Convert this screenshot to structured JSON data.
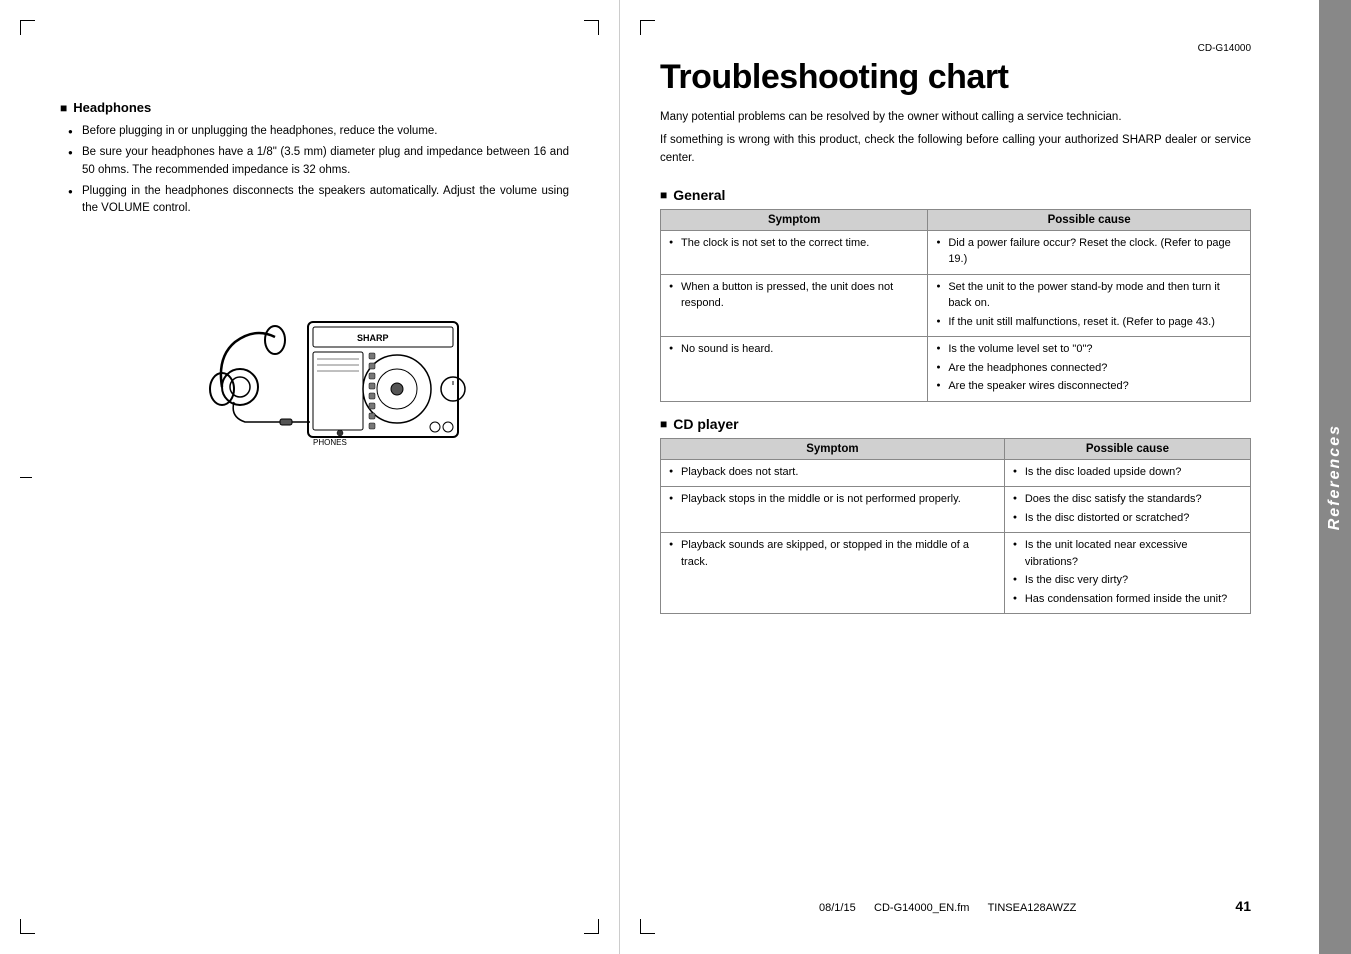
{
  "left": {
    "section_title": "Headphones",
    "bullets": [
      "Before plugging in or unplugging the headphones, reduce the volume.",
      "Be sure your headphones have a 1/8\" (3.5 mm) diameter plug and impedance between 16 and 50 ohms. The recommended impedance is 32 ohms.",
      "Plugging in the headphones disconnects the speakers automatically. Adjust the volume using the VOLUME control."
    ],
    "phones_label": "PHONES"
  },
  "right": {
    "model": "CD-G14000",
    "title": "Troubleshooting chart",
    "intro1": "Many potential problems can be resolved by the owner without calling a service technician.",
    "intro2": "If something is wrong with this product, check the following before calling your authorized SHARP dealer or service center.",
    "general": {
      "heading": "General",
      "col1": "Symptom",
      "col2": "Possible cause",
      "rows": [
        {
          "symptom": [
            "The clock is not set to the correct time."
          ],
          "cause": [
            "Did a power failure occur? Reset the clock. (Refer to page 19.)"
          ]
        },
        {
          "symptom": [
            "When a button is pressed, the unit does not respond."
          ],
          "cause": [
            "Set the unit to the power stand-by mode and then turn it back on.",
            "If the unit still malfunctions, reset it. (Refer to page 43.)"
          ]
        },
        {
          "symptom": [
            "No sound is heard."
          ],
          "cause": [
            "Is the volume level set to \"0\"?",
            "Are the headphones connected?",
            "Are the speaker wires disconnected?"
          ]
        }
      ]
    },
    "cdplayer": {
      "heading": "CD player",
      "col1": "Symptom",
      "col2": "Possible cause",
      "rows": [
        {
          "symptom": [
            "Playback does not start."
          ],
          "cause": [
            "Is the disc loaded upside down?"
          ]
        },
        {
          "symptom": [
            "Playback stops in the middle or is not performed properly."
          ],
          "cause": [
            "Does the disc satisfy the standards?",
            "Is the disc distorted or scratched?"
          ]
        },
        {
          "symptom": [
            "Playback sounds are skipped, or stopped in the middle of a track."
          ],
          "cause": [
            "Is the unit located near excessive vibrations?",
            "Is the disc very dirty?",
            "Has condensation formed inside the unit?"
          ]
        }
      ]
    },
    "sidebar_label": "References",
    "page_number": "41",
    "footer_left": "08/1/15",
    "footer_center": "CD-G14000_EN.fm",
    "footer_right": "TINSEA128AWZZ"
  }
}
